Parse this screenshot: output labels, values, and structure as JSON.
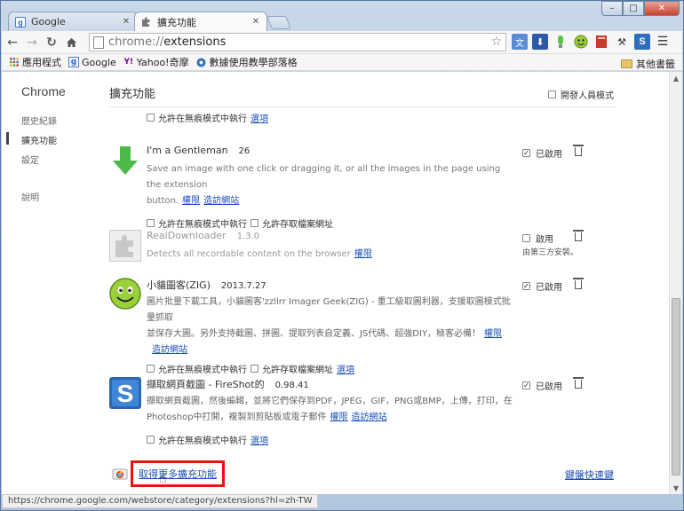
{
  "window": {
    "minimize": "–",
    "maximize": "□",
    "close": "✕"
  },
  "tabs": [
    {
      "title": "Google",
      "icon": "google-favicon",
      "active": false
    },
    {
      "title": "擴充功能",
      "icon": "puzzle-icon",
      "active": true
    }
  ],
  "toolbar": {
    "url_scheme": "chrome://",
    "url_path": "extensions",
    "icons": [
      "back-icon",
      "forward-icon",
      "reload-icon",
      "home-icon",
      "star-icon"
    ],
    "extensions": [
      "translate-ext",
      "download-ext",
      "lamp-ext",
      "smiley-ext",
      "book-ext",
      "wrench-ext",
      "fireshot-ext",
      "menu-icon"
    ]
  },
  "bookmarks": {
    "items": [
      {
        "label": "應用程式",
        "icon": "apps-grid-icon"
      },
      {
        "label": "Google",
        "icon": "google-icon"
      },
      {
        "label": "Yahoo!奇摩",
        "icon": "yahoo-icon"
      },
      {
        "label": "數據使用教學部落格",
        "icon": "blog-icon"
      }
    ],
    "other": "其他書籤"
  },
  "sidebar": {
    "title": "Chrome",
    "items": [
      "歷史紀錄",
      "擴充功能",
      "設定",
      "說明"
    ]
  },
  "main": {
    "title": "擴充功能",
    "dev_mode_label": "開發人員模式",
    "top_row": {
      "incognito": "允許在無痕模式中執行",
      "options": "選項"
    }
  },
  "extensions": [
    {
      "name": "I'm a Gentleman",
      "version": "26",
      "description": "Save an image with one click or dragging it, or all the images in the page using the extension",
      "description2": "button.",
      "links": [
        "權限",
        "造訪網站"
      ],
      "options": [
        "允許在無痕模式中執行",
        "允許存取檔案網址"
      ],
      "enabled_label": "已啟用",
      "enabled": true
    },
    {
      "name": "RealDownloader",
      "version": "1.3.0",
      "description": "Detects all recordable content on the browser",
      "links": [
        "權限"
      ],
      "enabled_label": "啟用",
      "enabled": false,
      "note": "由第三方安裝。"
    },
    {
      "name": "小貓圖客(ZIG)",
      "version": "2013.7.27",
      "description": "圖片批量下載工具，小貓圖客'zzllrr Imager Geek(ZIG) - 重工級取圖利器，支援取圖模式批量抓取",
      "description2": "並保存大圖。另外支持截圖、拼圖、提取列表自定義、JS代碼、超強DIY，極客必備！",
      "links": [
        "權限"
      ],
      "links2": [
        "造訪網站"
      ],
      "options": [
        "允許在無痕模式中執行",
        "允許存取檔案網址"
      ],
      "options_link": "選項",
      "enabled_label": "已啟用",
      "enabled": true
    },
    {
      "name": "擷取網頁截圖 - FireShot的",
      "version": "0.98.41",
      "description": "擷取網頁截圖，然後編輯，並將它們保存到PDF，JPEG，GIF，PNG或BMP，上傳，打印，在",
      "description2": "Photoshop中打開，複製到剪貼板或電子郵件",
      "links": [
        "權限",
        "造訪網站"
      ],
      "options": [
        "允許在無痕模式中執行"
      ],
      "options_link": "選項",
      "enabled_label": "已啟用",
      "enabled": true
    }
  ],
  "footer": {
    "get_more": "取得更多擴充功能",
    "shortcuts": "鍵盤快速鍵"
  },
  "status_url": "https://chrome.google.com/webstore/category/extensions?hl=zh-TW"
}
